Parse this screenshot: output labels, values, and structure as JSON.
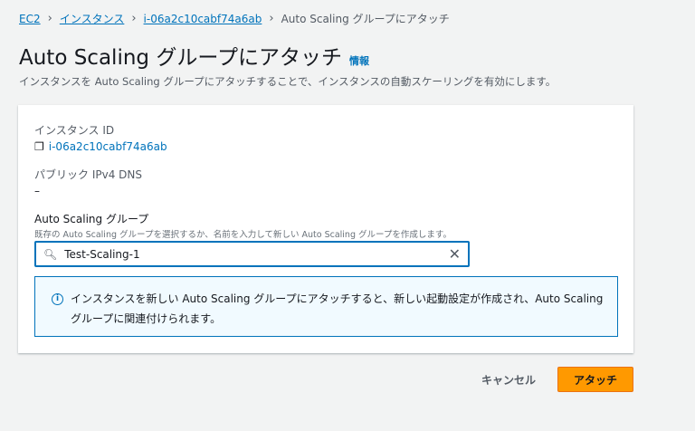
{
  "breadcrumb": {
    "items": [
      "EC2",
      "インスタンス",
      "i-06a2c10cabf74a6ab"
    ],
    "current": "Auto Scaling グループにアタッチ"
  },
  "header": {
    "title": "Auto Scaling グループにアタッチ",
    "info": "情報",
    "description": "インスタンスを Auto Scaling グループにアタッチすることで、インスタンスの自動スケーリングを有効にします。"
  },
  "form": {
    "instance_id_label": "インスタンス ID",
    "instance_id": "i-06a2c10cabf74a6ab",
    "dns_label": "パブリック IPv4 DNS",
    "dns_value": "–",
    "asg_label": "Auto Scaling グループ",
    "asg_hint": "既存の Auto Scaling グループを選択するか、名前を入力して新しい Auto Scaling グループを作成します。",
    "asg_value": "Test-Scaling-1",
    "alert": "インスタンスを新しい Auto Scaling グループにアタッチすると、新しい起動設定が作成され、Auto Scaling グループに関連付けられます。"
  },
  "actions": {
    "cancel": "キャンセル",
    "attach": "アタッチ"
  }
}
